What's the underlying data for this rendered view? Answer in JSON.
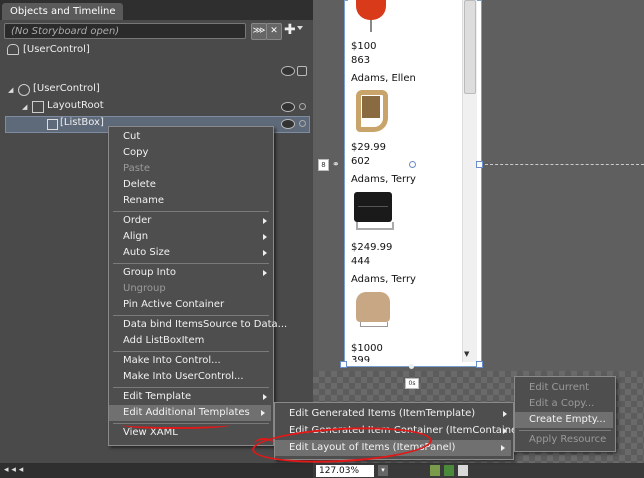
{
  "panel": {
    "tab_label": "Objects and Timeline",
    "pin_glyph": "↓",
    "close_glyph": "×",
    "storyboard_text": "(No Storyboard open)",
    "root_label": "[UserControl]",
    "tree": [
      {
        "label": "[UserControl]"
      },
      {
        "label": "LayoutRoot"
      },
      {
        "label": "[ListBox]"
      }
    ]
  },
  "artboard": {
    "items": [
      {
        "price": "$100",
        "stock": "863",
        "name": "Adams, Ellen"
      },
      {
        "price": "$29.99",
        "stock": "602",
        "name": "Adams, Terry"
      },
      {
        "price": "$249.99",
        "stock": "444",
        "name": "Adams, Terry"
      },
      {
        "price": "$1000",
        "stock": "399",
        "name": ""
      }
    ],
    "size_badge": "8",
    "bottom_badge": "0s",
    "zoom": "127.03%"
  },
  "context_menu": {
    "items": [
      "Cut",
      "Copy",
      "Paste",
      "Delete",
      "Rename",
      "Order",
      "Align",
      "Auto Size",
      "Group Into",
      "Ungroup",
      "Pin Active Container",
      "Data bind ItemsSource to Data...",
      "Add ListBoxItem",
      "Make Into Control...",
      "Make Into UserControl...",
      "Edit Template",
      "Edit Additional Templates",
      "View XAML"
    ]
  },
  "submenu": {
    "items": [
      "Edit Generated Items (ItemTemplate)",
      "Edit Generated Item Container (ItemContainerStyle)",
      "Edit Layout of Items (ItemsPanel)"
    ]
  },
  "template_menu": {
    "items": [
      "Edit Current",
      "Edit a Copy...",
      "Create Empty...",
      "Apply Resource"
    ]
  },
  "colors": {
    "highlight_annotation": "#e01818",
    "panel_bg": "#4a4a4a"
  }
}
